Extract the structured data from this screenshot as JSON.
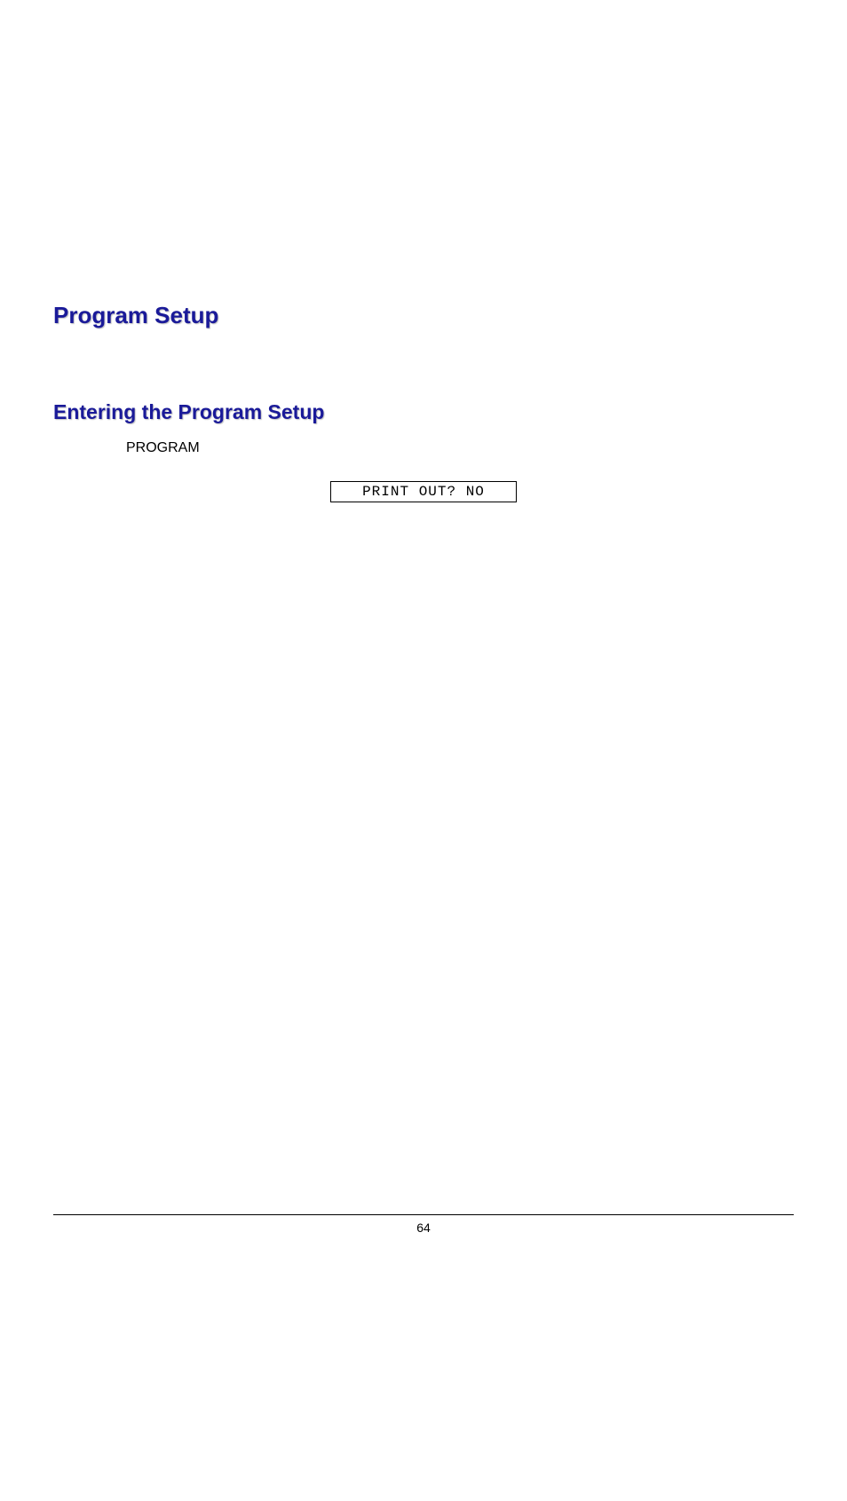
{
  "heading1": "Program Setup",
  "heading2": "Entering the Program Setup",
  "bodyText": "PROGRAM",
  "lcdDisplay": "PRINT OUT? NO",
  "pageNumber": "64"
}
